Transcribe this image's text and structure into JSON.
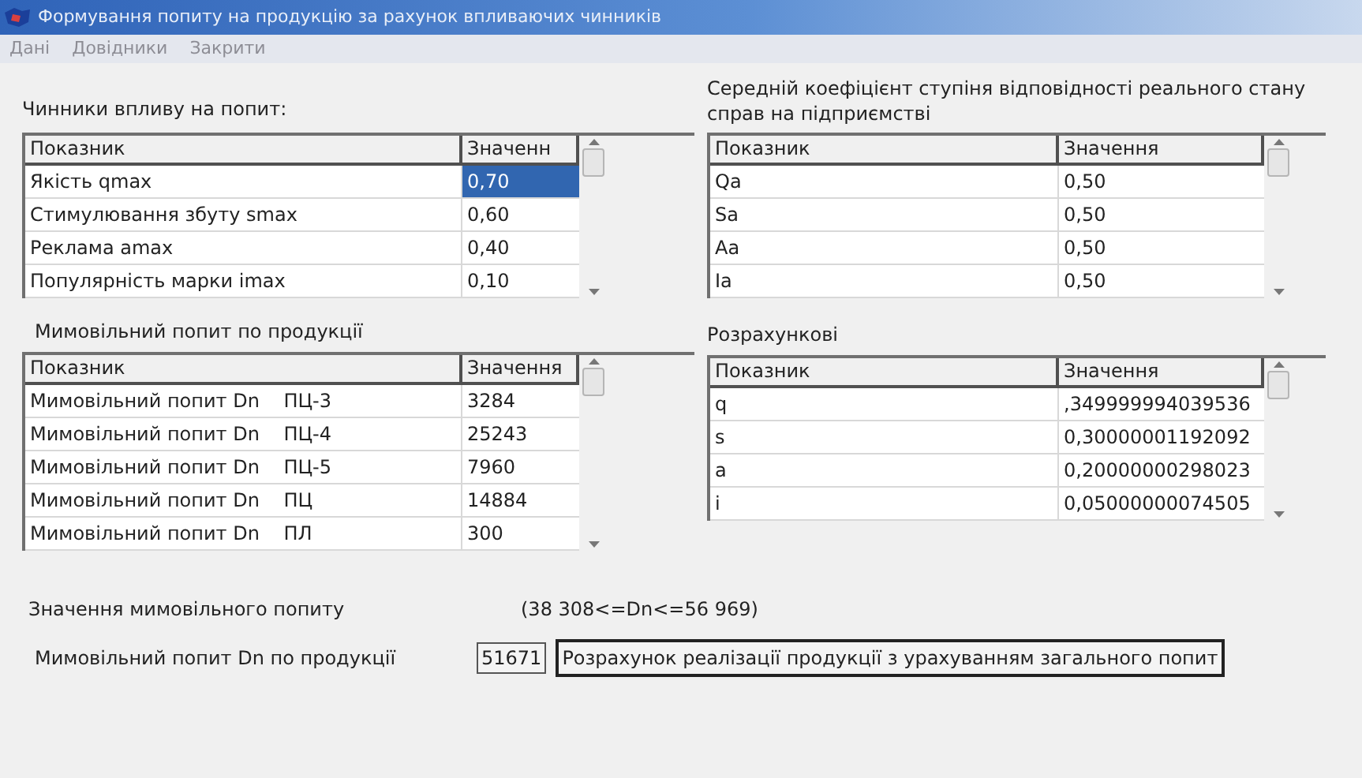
{
  "window": {
    "title": "Формування попиту на продукцію за рахунок впливаючих чинників"
  },
  "menu": [
    "Дані",
    "Довідники",
    "Закрити"
  ],
  "factors": {
    "title": "Чинники впливу на попит:",
    "columns": [
      "Показник",
      "Значенн"
    ],
    "rows": [
      {
        "name": "Якість qmax",
        "value": "0,70",
        "selected": true
      },
      {
        "name": "Стимулювання збуту smax",
        "value": "0,60",
        "selected": false
      },
      {
        "name": "Реклама amax",
        "value": "0,40",
        "selected": false
      },
      {
        "name": "Популярність марки imax",
        "value": "0,10",
        "selected": false
      }
    ]
  },
  "coefficients": {
    "title": "Середній коефіцієнт ступіня відповідності реального стану справ на підприємстві",
    "columns": [
      "Показник",
      "Значення"
    ],
    "rows": [
      {
        "name": "Qa",
        "value": "0,50"
      },
      {
        "name": "Sa",
        "value": "0,50"
      },
      {
        "name": "Aa",
        "value": "0,50"
      },
      {
        "name": "Ia",
        "value": "0,50"
      }
    ]
  },
  "spontaneous": {
    "title": "Мимовільний попит по продукції",
    "columns": [
      "Показник",
      "Значення"
    ],
    "rows": [
      {
        "name": "Мимовільний попит Dn    ПЦ-3",
        "value": "3284"
      },
      {
        "name": "Мимовільний попит Dn    ПЦ-4",
        "value": "25243"
      },
      {
        "name": "Мимовільний попит Dn    ПЦ-5",
        "value": "7960"
      },
      {
        "name": "Мимовільний попит Dn    ПЦ",
        "value": "14884"
      },
      {
        "name": "Мимовільний попит Dn    ПЛ",
        "value": "300"
      }
    ]
  },
  "calculated": {
    "title": "Розрахункові",
    "columns": [
      "Показник",
      "Значення"
    ],
    "rows": [
      {
        "name": "q",
        "value": ",349999994039536"
      },
      {
        "name": "s",
        "value": "0,30000001192092"
      },
      {
        "name": "a",
        "value": "0,20000000298023"
      },
      {
        "name": "i",
        "value": "0,05000000074505"
      }
    ]
  },
  "range_label": "Значення мимовільного попиту",
  "range": "(38 308<=Dn<=56 969)",
  "result_label": "Мимовільний попит Dn по продукції",
  "result_value": "51671",
  "calculate_button": "Розрахунок реалізації продукції з урахуванням загального попит"
}
